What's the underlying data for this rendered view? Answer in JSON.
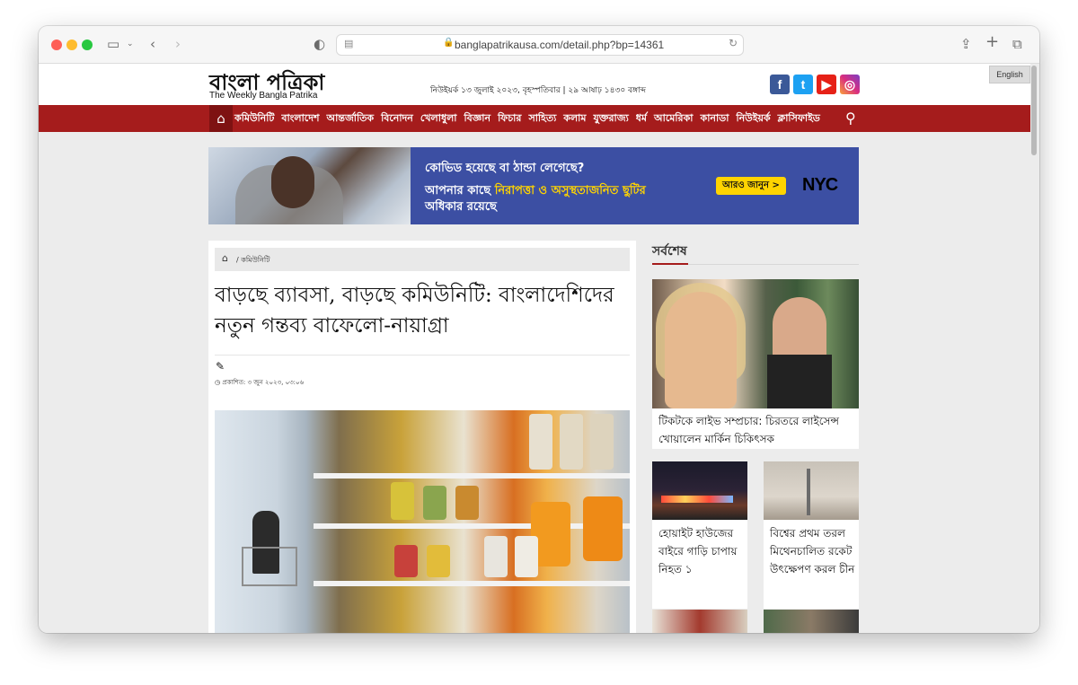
{
  "browser": {
    "url": "banglapatrikausa.com/detail.php?bp=14361",
    "icons": [
      "sidebar-icon",
      "back-icon",
      "forward-icon",
      "shield-icon",
      "share-icon",
      "new-tab-icon",
      "tabs-icon"
    ]
  },
  "site": {
    "logo_bn": "বাংলা পত্রিকা",
    "logo_en": "The Weekly Bangla Patrika",
    "dateline": "নিউইয়র্ক ১৩ জুলাই ২০২৩, বৃহস্পতিবার | ২৯ আষাঢ় ১৪৩০ বঙ্গাব্দ",
    "language_button": "English",
    "social": {
      "facebook": "f",
      "twitter": "t",
      "youtube": "▶",
      "instagram": "◎"
    }
  },
  "nav": {
    "items": [
      "কমিউনিটি",
      "বাংলাদেশ",
      "আন্তর্জাতিক",
      "বিনোদন",
      "খেলাধুলা",
      "বিজ্ঞান",
      "ফিচার",
      "সাহিত্য",
      "কলাম",
      "যুক্তরাজ্য",
      "ধর্ম",
      "আমেরিকা",
      "কানাডা",
      "নিউইয়র্ক",
      "ক্লাসিফাইড"
    ]
  },
  "banner": {
    "question": "কোভিড হয়েছে বা ঠান্ডা লেগেছে?",
    "line1_a": "আপনার কাছে ",
    "line1_highlight": "নিরাপত্তা ও অসুস্থতাজনিত ছুটির",
    "line2": "অধিকার রয়েছে",
    "button": "আরও জানুন >",
    "brand": "NYC"
  },
  "article": {
    "breadcrumb": "/ কমিউনিটি",
    "headline": "বাড়ছে ব্যাবসা, বাড়ছে কমিউনিটি: বাংলাদেশিদের নতুন গন্তব্য বাফেলো-নায়াগ্রা",
    "published": "প্রকাশিত: ৩ জুন ২০২৩, ০৩:০৬"
  },
  "sidebar": {
    "title": "সর্বশেষ",
    "featured_title": "টিকটকে লাইভ সম্প্রচার: চিরতরে লাইসেন্স খোয়ালেন মার্কিন চিকিৎসক",
    "cards": [
      {
        "title": "হোয়াইট হাউজের বাইরে গাড়ি চাপায় নিহত ১"
      },
      {
        "title": "বিশ্বের প্রথম তরল মিথেনচালিত রকেট উৎক্ষেপণ করল চীন"
      }
    ]
  }
}
